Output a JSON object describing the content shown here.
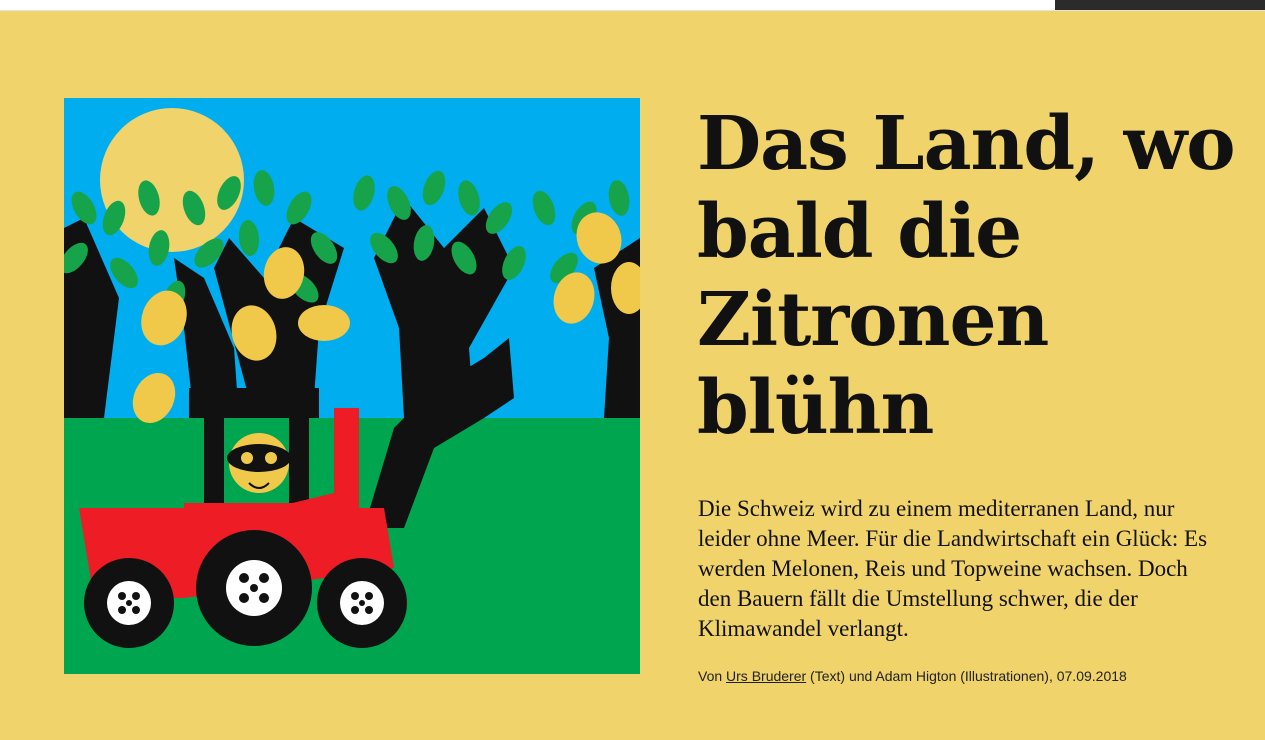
{
  "article": {
    "title": "Das Land, wo bald die Zitronen blühn",
    "lead": "Die Schweiz wird zu einem mediterranen Land, nur leider ohne Meer. Für die Landwirtschaft ein Glück: Es werden Melonen, Reis und Topweine wachsen. Doch den Bauern fällt die Umstellung schwer, die der Klimawandel verlangt.",
    "byline": {
      "prefix": "Von ",
      "author": "Urs Bruderer",
      "middle": " (Text) und Adam Higton (Illustrationen), ",
      "date": "07.09.2018"
    }
  },
  "colors": {
    "background": "#f0d36a",
    "sky": "#00aef0",
    "grass": "#00a550",
    "tractor": "#ee1c25",
    "leaf": "#16a34a",
    "lemon": "#f0c84a"
  }
}
